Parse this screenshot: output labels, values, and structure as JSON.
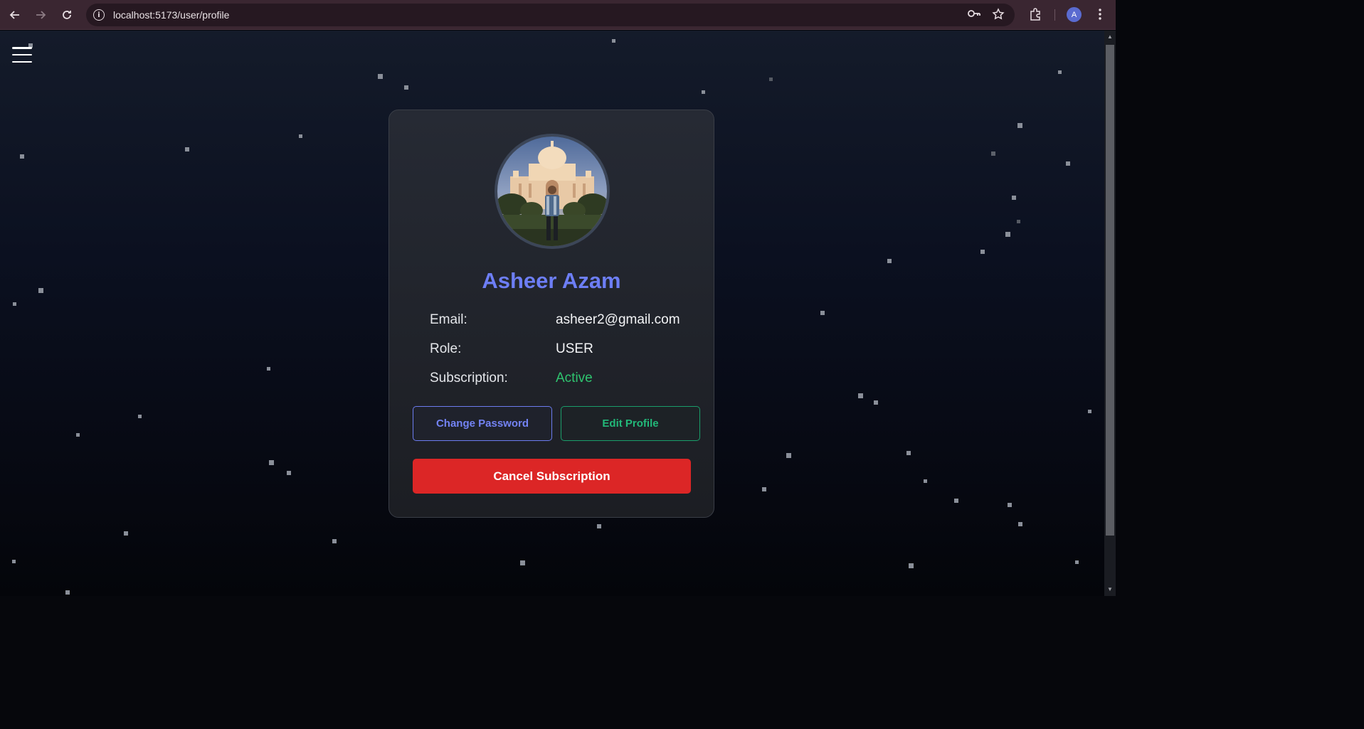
{
  "browser": {
    "url": "localhost:5173/user/profile",
    "profile_initial": "A"
  },
  "profile": {
    "name": "Asheer Azam",
    "fields": [
      {
        "label": "Email:",
        "value": "asheer2@gmail.com"
      },
      {
        "label": "Role:",
        "value": "USER"
      },
      {
        "label": "Subscription:",
        "value": "Active"
      }
    ],
    "buttons": {
      "change_password": "Change Password",
      "edit_profile": "Edit Profile",
      "cancel_subscription": "Cancel Subscription"
    }
  },
  "colors": {
    "name_accent": "#6d7ef5",
    "active_status": "#2fc46f",
    "danger": "#dc2626",
    "edit_accent": "#22b879"
  }
}
